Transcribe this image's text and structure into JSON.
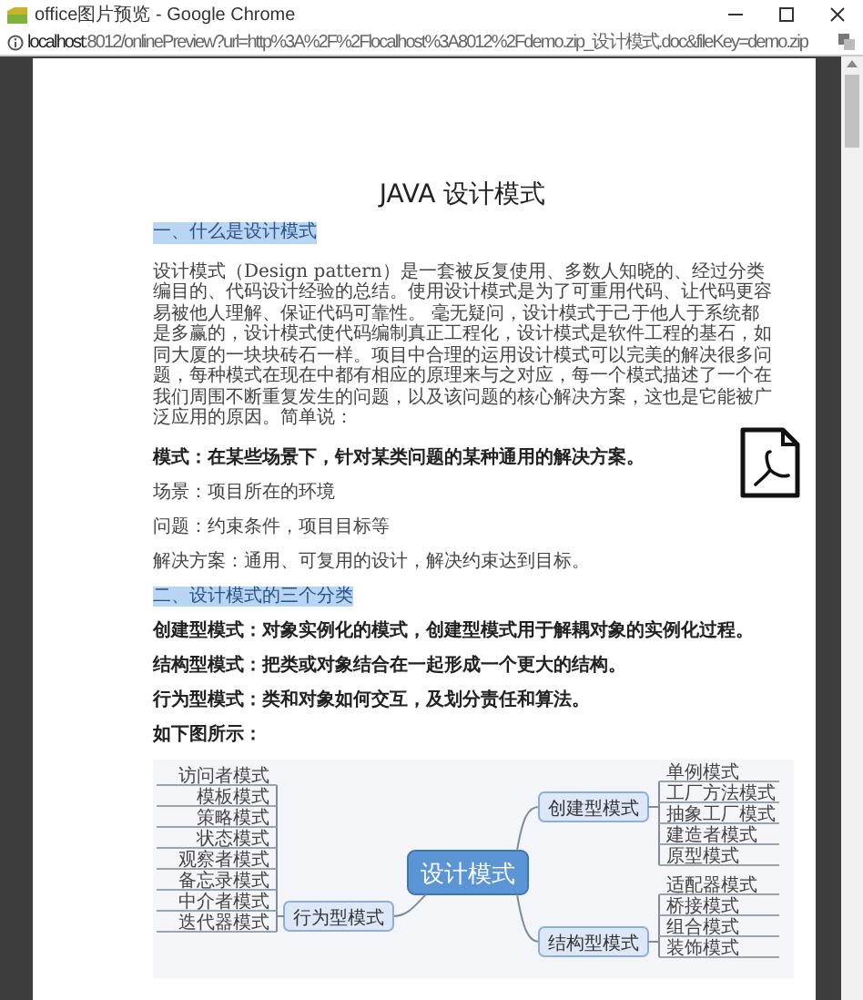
{
  "window": {
    "title": "office图片预览 - Google Chrome"
  },
  "address_bar": {
    "url": "**localhost**:8012/onlinePreview?url=http%3A%2F%2Flocalhost%3A8012%2Fdemo.zip_设计模式.doc&fileKey=demo.zip"
  },
  "document": {
    "title": "JAVA 设计模式",
    "blocks": [
      {
        "kind": "heading",
        "text": "一、什么是设计模式"
      },
      {
        "kind": "paragraph",
        "text": "设计模式（Design pattern）是一套被反复使用、多数人知晓的、经过分类编目的、代码设计经验的总结。使用设计模式是为了可重用代码、让代码更容易被他人理解、保证代码可靠性。 毫无疑问，设计模式于己于他人于系统都是多赢的，设计模式使代码编制真正工程化，设计模式是软件工程的基石，如同大厦的一块块砖石一样。项目中合理的运用设计模式可以完美的解决很多问题，每种模式在现在中都有相应的原理来与之对应，每一个模式描述了一个在我们周围不断重复发生的问题，以及该问题的核心解决方案，这也是它能被广泛应用的原因。简单说："
      },
      {
        "kind": "bold",
        "text": "模式：在某些场景下，针对某类问题的某种通用的解决方案。"
      },
      {
        "kind": "line",
        "text": "场景：项目所在的环境"
      },
      {
        "kind": "line",
        "text": "问题：约束条件，项目目标等"
      },
      {
        "kind": "line",
        "text": "解决方案：通用、可复用的设计，解决约束达到目标。"
      },
      {
        "kind": "heading",
        "text": "二、设计模式的三个分类"
      },
      {
        "kind": "bold",
        "text": "创建型模式：对象实例化的模式，创建型模式用于解耦对象的实例化过程。"
      },
      {
        "kind": "bold",
        "text": "结构型模式：把类或对象结合在一起形成一个更大的结构。"
      },
      {
        "kind": "bold",
        "text": "行为型模式：类和对象如何交互，及划分责任和算法。"
      },
      {
        "kind": "bold",
        "text": "如下图所示："
      }
    ],
    "mind_map": {
      "center": "设计模式",
      "branches": [
        {
          "label": "创建型模式",
          "leaves": [
            "单例模式",
            "工厂方法模式",
            "抽象工厂模式",
            "建造者模式",
            "原型模式"
          ]
        },
        {
          "label": "结构型模式",
          "leaves": [
            "适配器模式",
            "桥接模式",
            "组合模式",
            "装饰模式"
          ]
        },
        {
          "label": "行为型模式",
          "leaves": [
            "访问者模式",
            "模板模式",
            "策略模式",
            "状态模式",
            "观察者模式",
            "备忘录模式",
            "中介者模式",
            "迭代器模式"
          ]
        }
      ]
    }
  }
}
